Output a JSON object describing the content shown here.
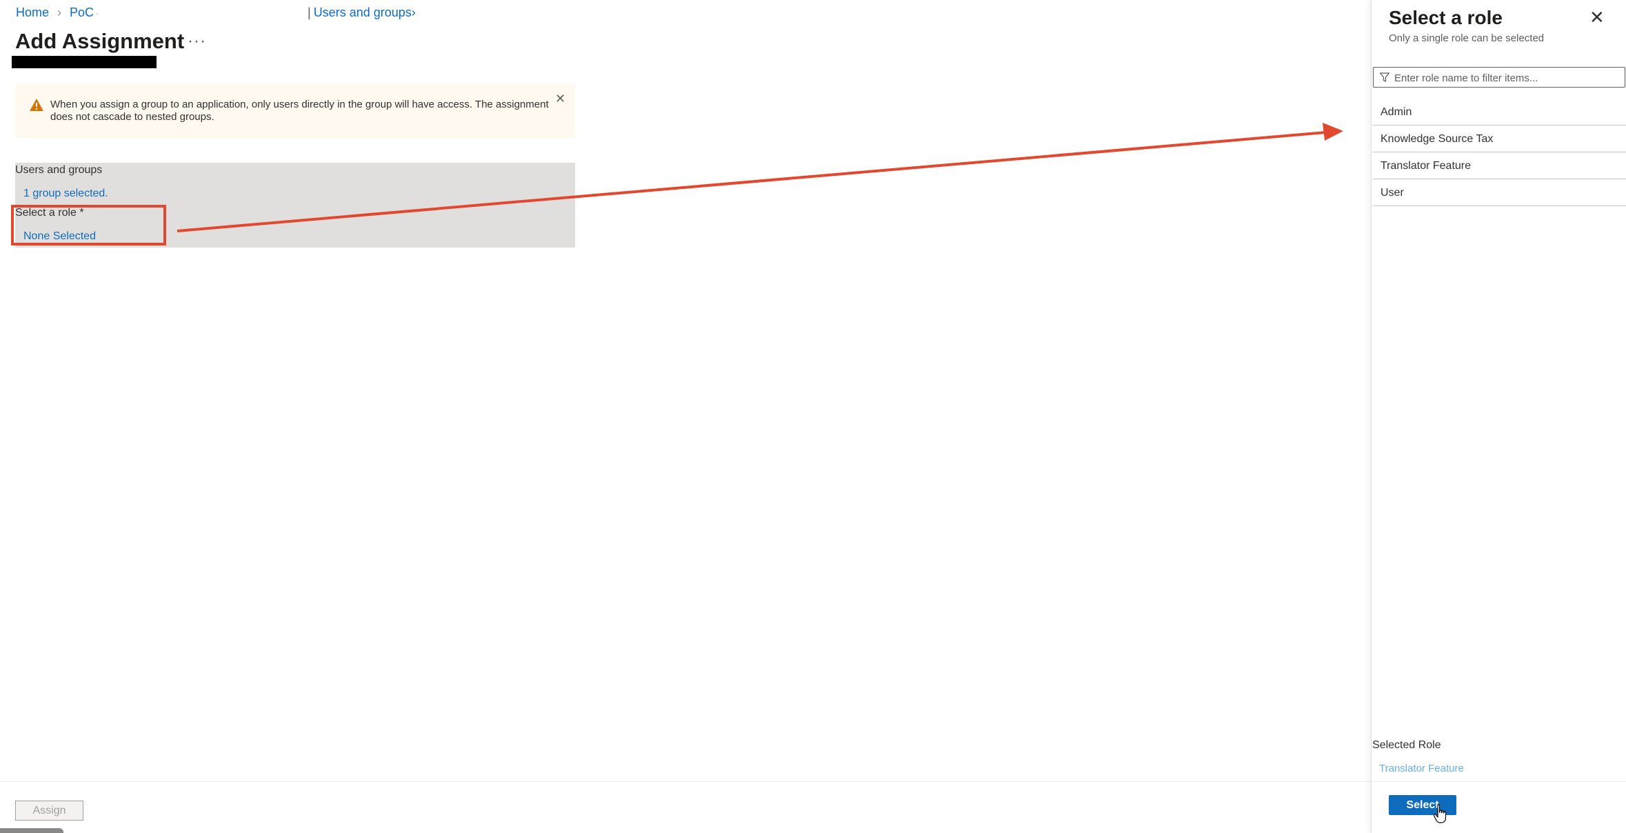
{
  "breadcrumb": {
    "home": "Home",
    "poc": "PoC",
    "users_and_groups": "Users and groups"
  },
  "page": {
    "title": "Add Assignment",
    "more": "···"
  },
  "warning": {
    "text": "When you assign a group to an application, only users directly in the group will have access. The assignment does not cascade to nested groups."
  },
  "form": {
    "users_label": "Users and groups",
    "users_value": "1 group selected.",
    "role_label": "Select a role *",
    "role_value": "None Selected"
  },
  "footer": {
    "assign_label": "Assign"
  },
  "panel": {
    "title": "Select a role",
    "subtitle": "Only a single role can be selected",
    "filter_placeholder": "Enter role name to filter items...",
    "roles": [
      "Admin",
      "Knowledge Source Tax",
      "Translator Feature",
      "User"
    ],
    "selected_role_label": "Selected Role",
    "selected_role_value": "Translator Feature",
    "select_label": "Select"
  },
  "colors": {
    "link": "#0f6cbd",
    "annotation": "#e0492f",
    "warning_icon": "#d47500",
    "warning_bg": "#fff9f0",
    "form_bg": "#e1dfdd",
    "primary_button": "#0f6cbd"
  },
  "icons": [
    "chevron-right-icon",
    "more-icon",
    "warning-icon",
    "close-icon",
    "filter-icon",
    "hand-cursor-icon"
  ]
}
